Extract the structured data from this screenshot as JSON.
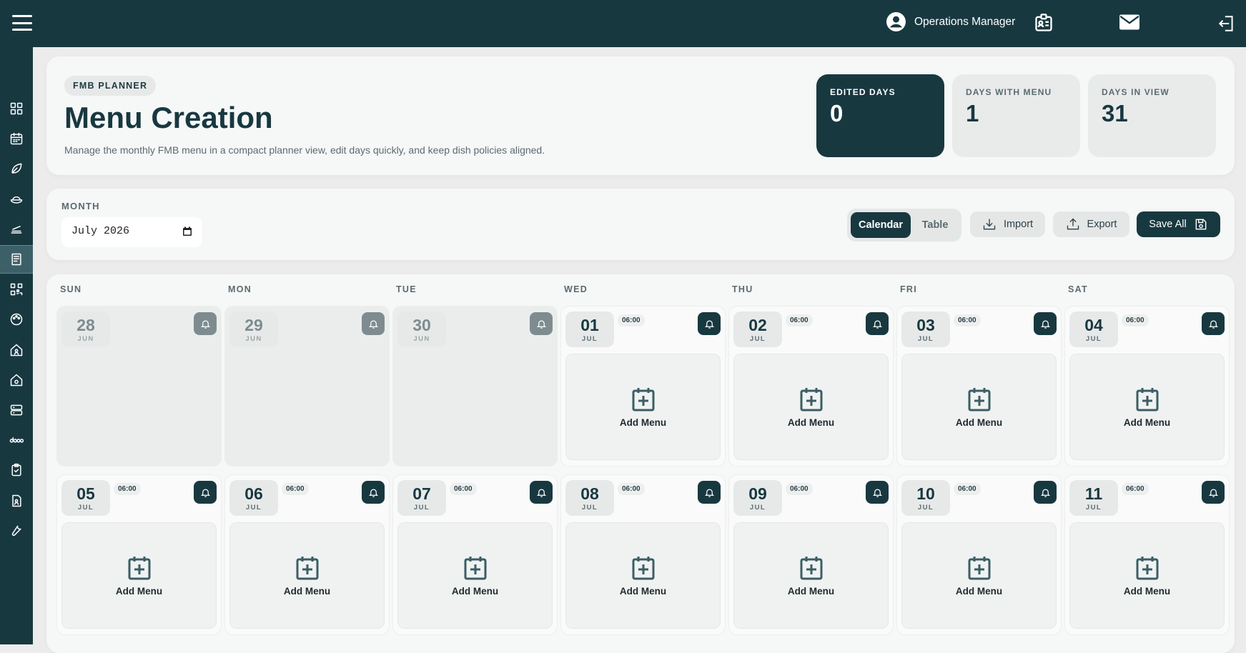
{
  "topbar": {
    "user_name": "Operations Manager",
    "icons": [
      "menu-icon",
      "user-circle-icon",
      "id-card-icon",
      "mail-icon",
      "logout-icon"
    ]
  },
  "sidebar": {
    "items": [
      {
        "icon": "dashboard-icon",
        "active": false
      },
      {
        "icon": "calendar-icon",
        "active": false
      },
      {
        "icon": "leaf-icon",
        "active": false
      },
      {
        "icon": "rice-bowl-icon",
        "active": false
      },
      {
        "icon": "food-tray-icon",
        "active": false
      },
      {
        "icon": "menu-book-icon",
        "active": true
      },
      {
        "icon": "qr-code-icon",
        "active": false
      },
      {
        "icon": "palette-icon",
        "active": false
      },
      {
        "icon": "house-user-icon",
        "active": false
      },
      {
        "icon": "house-gear-icon",
        "active": false
      },
      {
        "icon": "server-icon",
        "active": false
      },
      {
        "icon": "odoo-icon",
        "active": false
      },
      {
        "icon": "clipboard-check-icon",
        "active": false
      },
      {
        "icon": "document-user-icon",
        "active": false
      },
      {
        "icon": "wrench-icon",
        "active": false
      }
    ],
    "odoo_label": "odoo"
  },
  "header": {
    "badge": "FMB PLANNER",
    "title": "Menu Creation",
    "subtitle": "Manage the monthly FMB menu in a compact planner view, edit days quickly, and keep dish policies aligned.",
    "stats": [
      {
        "label": "EDITED DAYS",
        "value": "0"
      },
      {
        "label": "DAYS WITH MENU",
        "value": "1"
      },
      {
        "label": "DAYS IN VIEW",
        "value": "31"
      }
    ]
  },
  "controls": {
    "month_label": "MONTH",
    "month_value": "July 2026",
    "view_calendar": "Calendar",
    "view_table": "Table",
    "import_label": "Import",
    "export_label": "Export",
    "save_label": "Save All"
  },
  "calendar": {
    "weekdays": [
      "SUN",
      "MON",
      "TUE",
      "WED",
      "THU",
      "FRI",
      "SAT"
    ],
    "add_label": "Add Menu",
    "days": [
      {
        "num": "28",
        "month": "JUN",
        "other": true,
        "time": ""
      },
      {
        "num": "29",
        "month": "JUN",
        "other": true,
        "time": ""
      },
      {
        "num": "30",
        "month": "JUN",
        "other": true,
        "time": ""
      },
      {
        "num": "01",
        "month": "JUL",
        "other": false,
        "time": "06:00"
      },
      {
        "num": "02",
        "month": "JUL",
        "other": false,
        "time": "06:00"
      },
      {
        "num": "03",
        "month": "JUL",
        "other": false,
        "time": "06:00"
      },
      {
        "num": "04",
        "month": "JUL",
        "other": false,
        "time": "06:00"
      },
      {
        "num": "05",
        "month": "JUL",
        "other": false,
        "time": "06:00"
      },
      {
        "num": "06",
        "month": "JUL",
        "other": false,
        "time": "06:00"
      },
      {
        "num": "07",
        "month": "JUL",
        "other": false,
        "time": "06:00"
      },
      {
        "num": "08",
        "month": "JUL",
        "other": false,
        "time": "06:00"
      },
      {
        "num": "09",
        "month": "JUL",
        "other": false,
        "time": "06:00"
      },
      {
        "num": "10",
        "month": "JUL",
        "other": false,
        "time": "06:00"
      },
      {
        "num": "11",
        "month": "JUL",
        "other": false,
        "time": "06:00"
      }
    ]
  },
  "colors": {
    "primary": "#183840",
    "muted": "#5b6b6f",
    "background": "#ececec"
  }
}
